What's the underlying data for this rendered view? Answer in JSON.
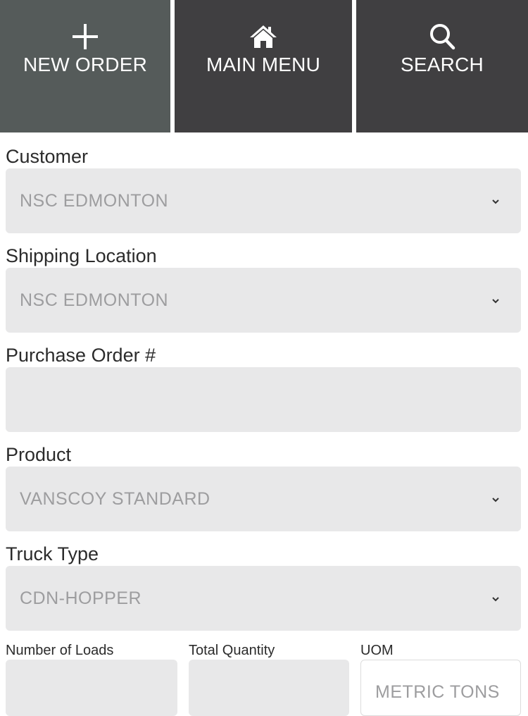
{
  "nav": {
    "new_order": {
      "label": "NEW ORDER",
      "icon": "plus-icon"
    },
    "main_menu": {
      "label": "MAIN MENU",
      "icon": "home-icon"
    },
    "search": {
      "label": "SEARCH",
      "icon": "search-icon"
    }
  },
  "form": {
    "customer": {
      "label": "Customer",
      "value": "NSC EDMONTON"
    },
    "shipping_location": {
      "label": "Shipping Location",
      "value": "NSC EDMONTON"
    },
    "purchase_order": {
      "label": "Purchase Order #",
      "value": ""
    },
    "product": {
      "label": "Product",
      "value": "VANSCOY STANDARD"
    },
    "truck_type": {
      "label": "Truck Type",
      "value": "CDN-HOPPER"
    },
    "number_of_loads": {
      "label": "Number of Loads",
      "value": ""
    },
    "total_quantity": {
      "label": "Total Quantity",
      "value": ""
    },
    "uom": {
      "label": "UOM",
      "value": "METRIC TONS"
    }
  },
  "colors": {
    "nav_active": "#555b5a",
    "nav_default": "#403f41",
    "field_bg": "#e8e8e9",
    "field_text": "#9d9d9f",
    "label_text": "#2b2b2b"
  }
}
